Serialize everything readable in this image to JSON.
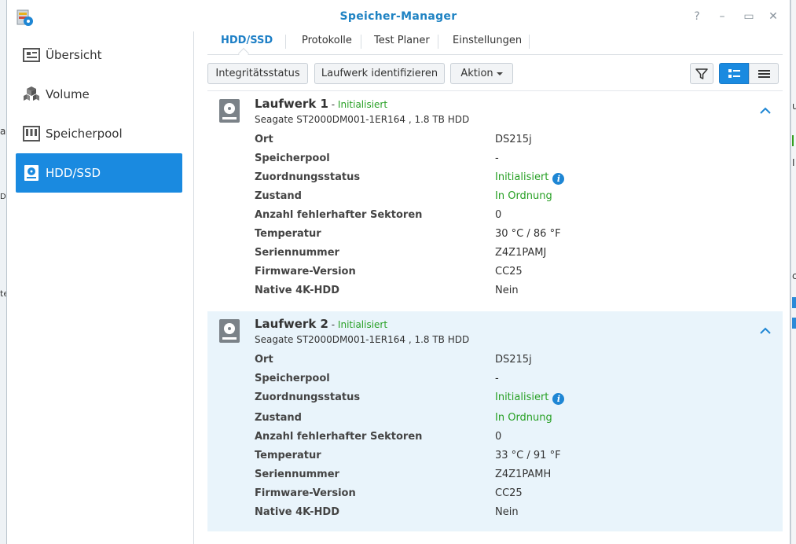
{
  "window": {
    "title": "Speicher-Manager"
  },
  "window_controls": {
    "help": "?",
    "minimize": "–",
    "maximize": "▭",
    "close": "✕"
  },
  "sidebar": {
    "items": [
      {
        "label": "Übersicht",
        "icon": "overview-icon"
      },
      {
        "label": "Volume",
        "icon": "volume-icon"
      },
      {
        "label": "Speicherpool",
        "icon": "storage-pool-icon"
      },
      {
        "label": "HDD/SSD",
        "icon": "hdd-icon",
        "active": true
      }
    ]
  },
  "tabs": [
    {
      "label": "HDD/SSD",
      "active": true
    },
    {
      "label": "Protokolle"
    },
    {
      "label": "Test Planer"
    },
    {
      "label": "Einstellungen"
    }
  ],
  "toolbar": {
    "integrity_label": "Integritätsstatus",
    "identify_label": "Laufwerk identifizieren",
    "action_label": "Aktion",
    "filter_icon": "filter-icon",
    "view_detail_icon": "detail-view-icon",
    "view_list_icon": "list-view-icon"
  },
  "drives": [
    {
      "name": "Laufwerk 1",
      "separator": " - ",
      "status": "Initialisiert",
      "model": "Seagate ST2000DM001-1ER164 , 1.8 TB HDD",
      "details": [
        {
          "key": "Ort",
          "value": "DS215j"
        },
        {
          "key": "Speicherpool",
          "value": "-"
        },
        {
          "key": "Zuordnungsstatus",
          "value": "Initialisiert"
        },
        {
          "key": "Zustand",
          "value": "In Ordnung"
        },
        {
          "key": "Anzahl fehlerhafter Sektoren",
          "value": "0"
        },
        {
          "key": "Temperatur",
          "value": "30 °C / 86 °F"
        },
        {
          "key": "Seriennummer",
          "value": "Z4Z1PAMJ"
        },
        {
          "key": "Firmware-Version",
          "value": "CC25"
        },
        {
          "key": "Native 4K-HDD",
          "value": "Nein"
        }
      ]
    },
    {
      "name": "Laufwerk 2",
      "separator": " - ",
      "status": "Initialisiert",
      "model": "Seagate ST2000DM001-1ER164 , 1.8 TB HDD",
      "details": [
        {
          "key": "Ort",
          "value": "DS215j"
        },
        {
          "key": "Speicherpool",
          "value": "-"
        },
        {
          "key": "Zuordnungsstatus",
          "value": "Initialisiert"
        },
        {
          "key": "Zustand",
          "value": "In Ordnung"
        },
        {
          "key": "Anzahl fehlerhafter Sektoren",
          "value": "0"
        },
        {
          "key": "Temperatur",
          "value": "33 °C / 91 °F"
        },
        {
          "key": "Seriennummer",
          "value": "Z4Z1PAMH"
        },
        {
          "key": "Firmware-Version",
          "value": "CC25"
        },
        {
          "key": "Native 4K-HDD",
          "value": "Nein"
        }
      ]
    }
  ],
  "info_icon_glyph": "i",
  "background_window": {
    "left_fragments": [
      "a",
      "Da",
      "te"
    ],
    "right_fragments": [
      "u",
      "]",
      "I",
      "c"
    ]
  },
  "colors": {
    "accent": "#1a8ae0",
    "title": "#1f83c3",
    "status_green": "#28a025",
    "selected_row": "#e9f4fb"
  }
}
